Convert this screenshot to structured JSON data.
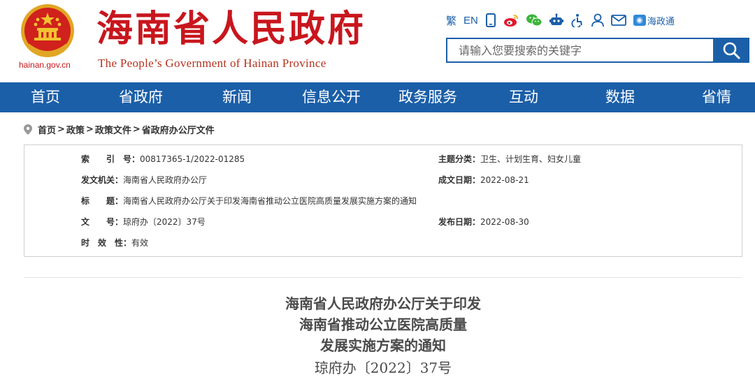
{
  "header": {
    "site_title": "海南省人民政府",
    "site_subtitle": "The People’s Government  of Hainan Province",
    "domain": "hainan.gov.cn"
  },
  "toolbar": {
    "traditional": "繁",
    "english": "EN",
    "hainan_tong": "海政通",
    "icons": [
      "mobile-icon",
      "weibo-icon",
      "wechat-icon",
      "robot-icon",
      "accessibility-icon",
      "user-icon",
      "mail-icon"
    ]
  },
  "search": {
    "placeholder": "请输入您要搜索的关键字"
  },
  "nav": {
    "items": [
      "首页",
      "省政府",
      "新闻",
      "信息公开",
      "政务服务",
      "互动",
      "数据",
      "省情"
    ]
  },
  "breadcrumb": [
    "首页",
    "政策",
    "政策文件",
    "省政府办公厅文件"
  ],
  "meta": {
    "index_label": "索　　引　号：",
    "index_value": "00817365-1/2022-01285",
    "topic_label": "主题分类：",
    "topic_value": "卫生、计划生育、妇女儿童",
    "issuer_label": "发文机关：",
    "issuer_value": "海南省人民政府办公厅",
    "created_label": "成文日期：",
    "created_value": "2022-08-21",
    "title_label": "标　　题：",
    "title_value": "海南省人民政府办公厅关于印发海南省推动公立医院高质量发展实施方案的通知",
    "number_label": "文　　号：",
    "number_value": "琼府办〔2022〕37号",
    "published_label": "发布日期：",
    "published_value": "2022-08-30",
    "validity_label": "时　效　性：",
    "validity_value": "有效"
  },
  "document": {
    "title_lines": [
      "海南省人民政府办公厅关于印发",
      "海南省推动公立医院高质量",
      "发展实施方案的通知"
    ],
    "number": "琼府办〔2022〕37号"
  },
  "colors": {
    "brand_red": "#c8161d",
    "nav_blue": "#1b5fa8"
  }
}
